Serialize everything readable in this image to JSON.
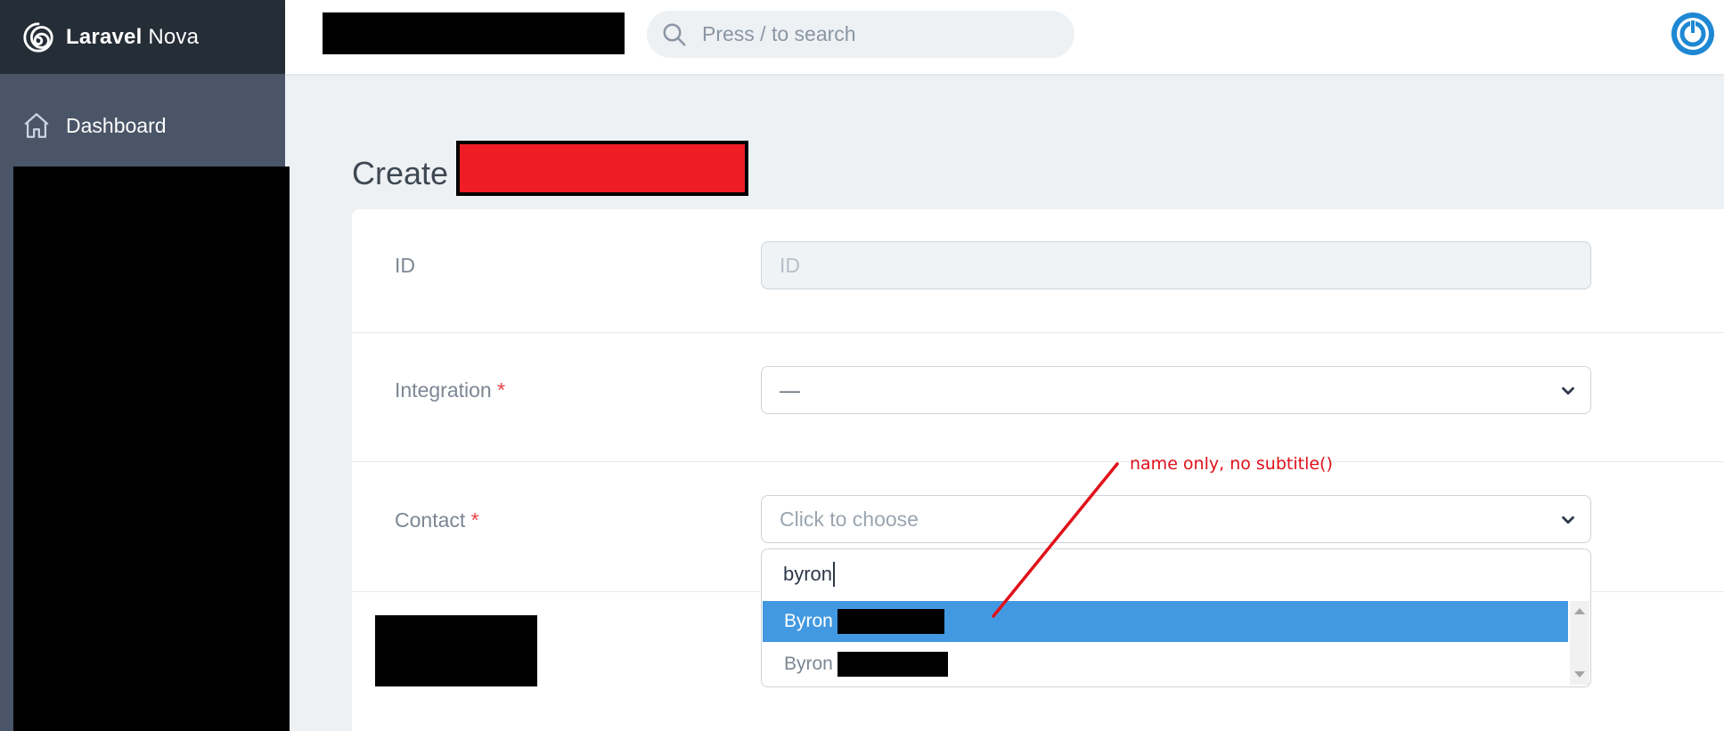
{
  "app": {
    "name_bold": "Laravel",
    "name_light": "Nova"
  },
  "sidebar": {
    "items": [
      {
        "label": "Dashboard",
        "icon": "home-icon"
      }
    ]
  },
  "search": {
    "placeholder": "Press / to search"
  },
  "page": {
    "title": "Create"
  },
  "form": {
    "id_field": {
      "label": "ID",
      "placeholder": "ID"
    },
    "integration_field": {
      "label": "Integration",
      "required": "*",
      "value": "—"
    },
    "contact_field": {
      "label": "Contact",
      "required": "*",
      "placeholder": "Click to choose",
      "search_value": "byron",
      "options": [
        {
          "label": "Byron"
        },
        {
          "label": "Byron"
        }
      ]
    }
  },
  "annotation": {
    "text": "name only, no subtitle()"
  },
  "colors": {
    "accent": "#4299e1",
    "sidebar": "#4a5568",
    "sidebar_header": "#252d37",
    "annotation": "#e0111a",
    "avatar": "#1e88d3"
  }
}
